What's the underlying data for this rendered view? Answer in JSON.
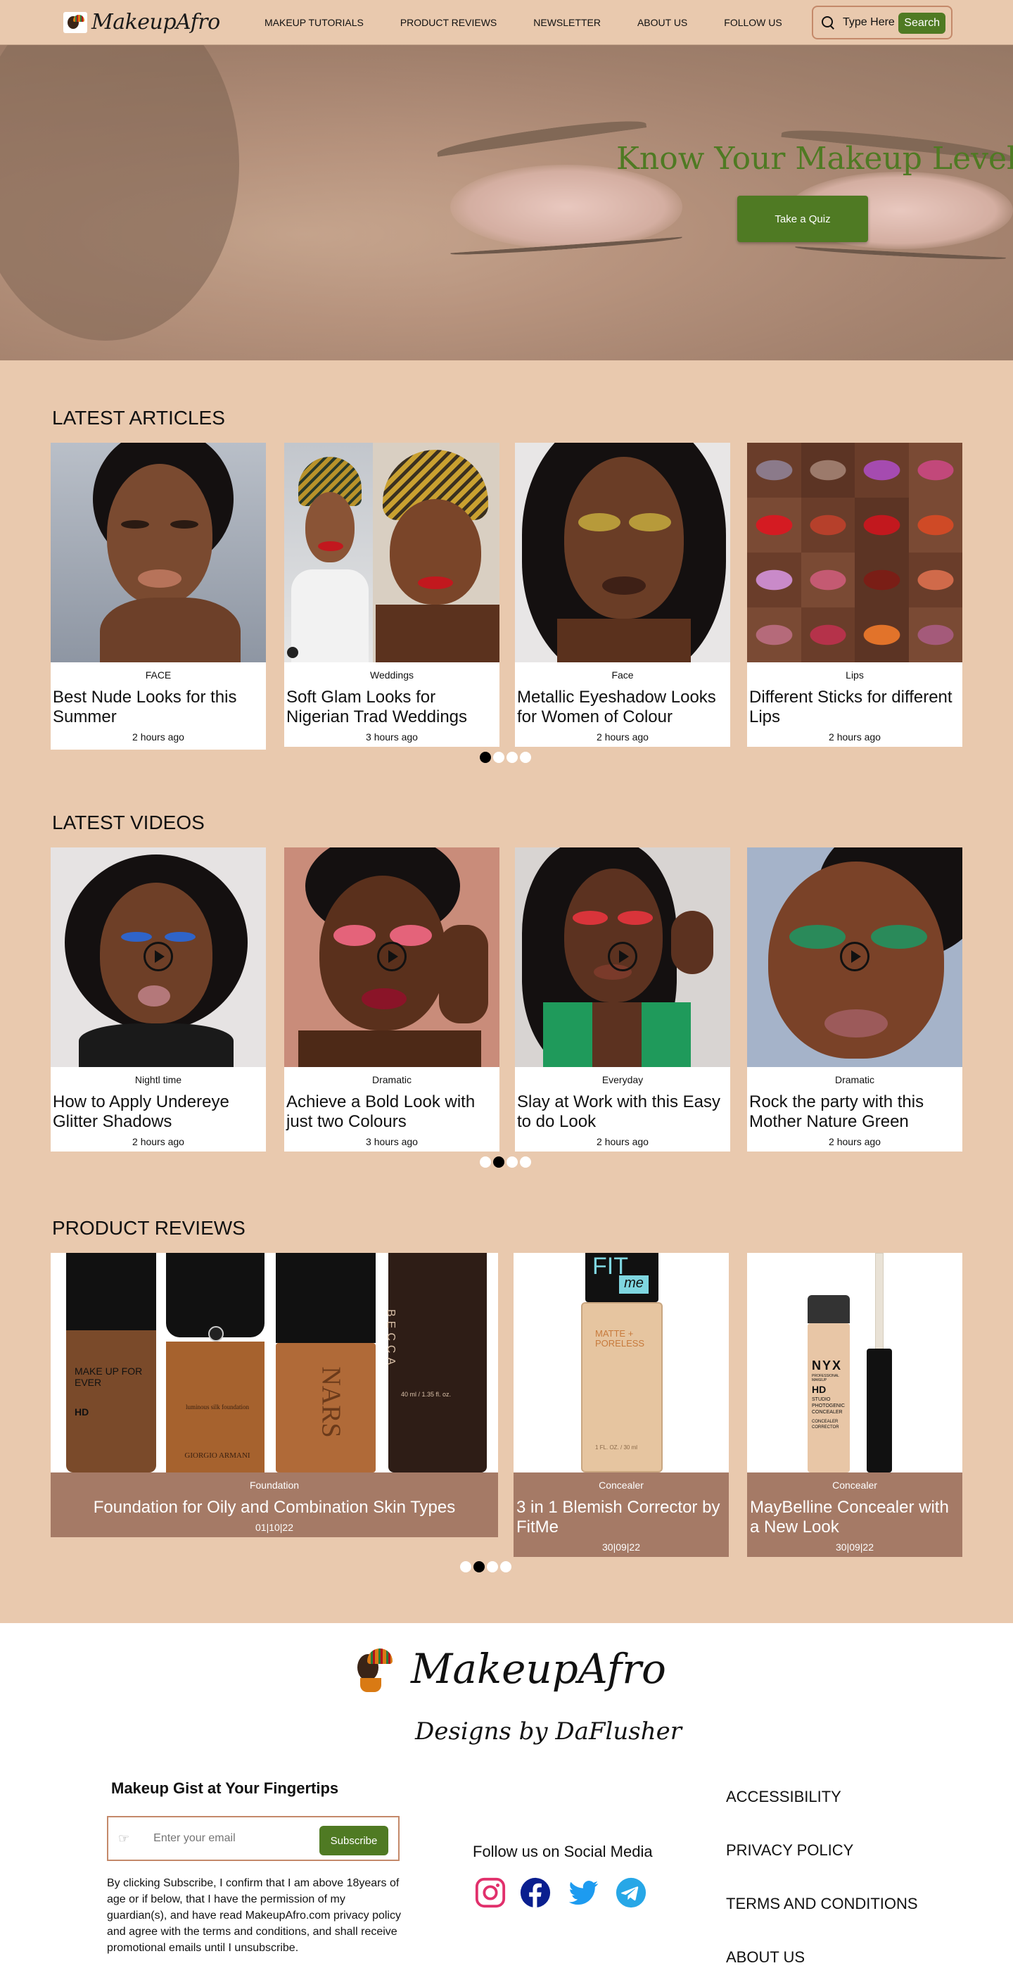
{
  "nav": {
    "logo_text": "MakeupAfro",
    "menu": [
      "MAKEUP TUTORIALS",
      "PRODUCT REVIEWS",
      "NEWSLETTER",
      "ABOUT US",
      "FOLLOW US"
    ],
    "search_text": "Type Here",
    "search_button": "Search"
  },
  "hero": {
    "title": "Know Your Makeup Level?",
    "button": "Take a Quiz"
  },
  "articles": {
    "heading": "LATEST ARTICLES",
    "items": [
      {
        "category": "FACE",
        "title": "Best Nude Looks for this Summer",
        "time": "2 hours ago"
      },
      {
        "category": "Weddings",
        "title": "Soft Glam Looks for Nigerian Trad Weddings",
        "time": "3 hours ago"
      },
      {
        "category": "Face",
        "title": "Metallic Eyeshadow Looks for Women of Colour",
        "time": "2 hours ago"
      },
      {
        "category": "Lips",
        "title": "Different Sticks for different Lips",
        "time": "2 hours ago"
      }
    ],
    "active_dot": 1
  },
  "videos": {
    "heading": "LATEST VIDEOS",
    "items": [
      {
        "category": "Nightl time",
        "title": "How to Apply Undereye Glitter Shadows",
        "time": "2 hours ago"
      },
      {
        "category": "Dramatic",
        "title": "Achieve a Bold Look with just two Colours",
        "time": "3 hours ago"
      },
      {
        "category": "Everyday",
        "title": "Slay at Work with this Easy to do Look",
        "time": "2 hours ago"
      },
      {
        "category": "Dramatic",
        "title": "Rock the party with this Mother Nature Green",
        "time": "2 hours ago"
      }
    ],
    "active_dot": 2
  },
  "reviews": {
    "heading": "PRODUCT REVIEWS",
    "items": [
      {
        "category": "Foundation",
        "title": "Foundation for Oily and Combination Skin Types",
        "date": "01|10|22"
      },
      {
        "category": "Concealer",
        "title": "3 in 1 Blemish Corrector by FitMe",
        "date": "30|09|22"
      },
      {
        "category": "Concealer",
        "title": "MayBelline Concealer with a New Look",
        "date": "30|09|22"
      }
    ],
    "product_labels": {
      "make_up_for_ever": "MAKE UP FOR EVER",
      "hd": "HD",
      "armani_line": "luminous silk foundation",
      "armani": "GIORGIO ARMANI",
      "nars": "NARS",
      "becca": "BECCA",
      "becca_size": "40 ml / 1.35 fl. oz.",
      "fit": "FIT",
      "me": "me",
      "matte_poreless": "MATTE + PORELESS",
      "fitme_size": "1 FL. OZ. / 30 ml",
      "nyx": "NYX",
      "nyx_sub": "PROFESSIONAL MAKEUP",
      "nyx_hd": "HD",
      "nyx_desc": "STUDIO PHOTOGENIC CONCEALER",
      "nyx_desc2": "CONCEALER CORRECTOR"
    },
    "active_dot": 2
  },
  "footer": {
    "logo_text": "MakeupAfro",
    "signature": "Designs by DaFlusher",
    "gist_heading": "Makeup Gist at Your Fingertips",
    "email_placeholder": "Enter your email",
    "subscribe_button": "Subscribe",
    "disclaimer": "By clicking Subscribe, I confirm that I am above 18years of age or if below, that I have the permission of my guardian(s), and have read MakeupAfro.com privacy policy and agree with the terms and conditions, and shall receive promotional emails until I unsubscribe.",
    "follow_heading": "Follow us on Social Media",
    "socials": [
      "instagram-icon",
      "facebook-icon",
      "twitter-icon",
      "telegram-icon"
    ],
    "links": [
      "ACCESSIBILITY",
      "PRIVACY POLICY",
      "TERMS AND CONDITIONS",
      "ABOUT US"
    ]
  },
  "colors": {
    "background": "#e9c9ae",
    "accent_green": "#4f7a23",
    "review_card": "#a57a66",
    "border": "#c4896a"
  }
}
